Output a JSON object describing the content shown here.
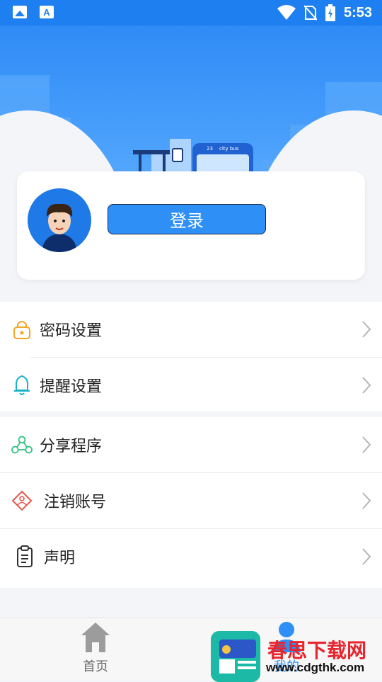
{
  "status_bar": {
    "time": "5:53",
    "icons": [
      "image-icon",
      "a-icon",
      "wifi-icon",
      "no-sim-icon",
      "battery-icon"
    ]
  },
  "profile": {
    "login_label": "登录"
  },
  "menu": {
    "password": "密码设置",
    "reminder": "提醒设置",
    "share": "分享程序",
    "deactivate": "注销账号",
    "statement": "声明"
  },
  "tabs": {
    "home": "首页",
    "mine": "我的"
  },
  "watermark": {
    "title": "春思下载网",
    "url": "www.cdgthk.com"
  },
  "colors": {
    "primary": "#2e8ff7",
    "statusbar": "#1e80f0"
  }
}
